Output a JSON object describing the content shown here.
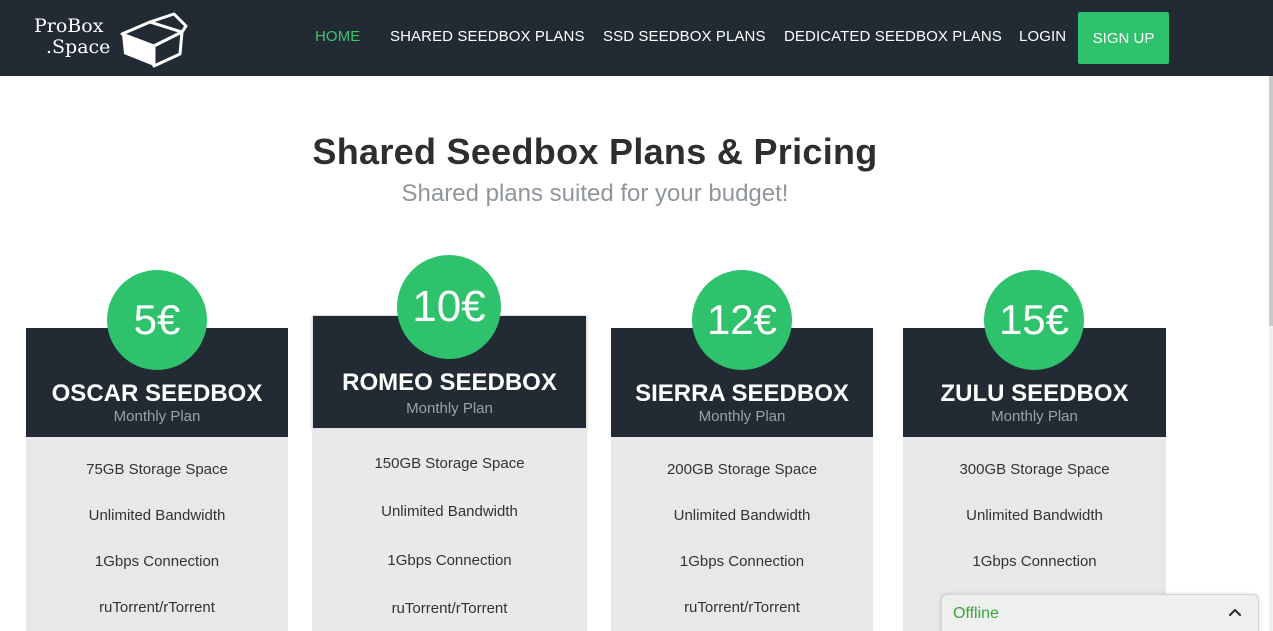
{
  "header": {
    "logo_line1": "ProBox",
    "logo_line2": ".Space",
    "nav": [
      {
        "label": "HOME",
        "active": true
      },
      {
        "label": "SHARED SEEDBOX PLANS",
        "active": false
      },
      {
        "label": "SSD SEEDBOX PLANS",
        "active": false
      },
      {
        "label": "DEDICATED SEEDBOX PLANS",
        "active": false
      },
      {
        "label": "LOGIN",
        "active": false
      }
    ],
    "signup_label": "SIGN UP"
  },
  "main": {
    "title": "Shared Seedbox Plans & Pricing",
    "subtitle": "Shared plans suited for your budget!"
  },
  "plans": [
    {
      "price": "5€",
      "name": "OSCAR SEEDBOX",
      "period": "Monthly Plan",
      "features": [
        "75GB Storage Space",
        "Unlimited Bandwidth",
        "1Gbps Connection",
        "ruTorrent/rTorrent"
      ]
    },
    {
      "price": "10€",
      "name": "ROMEO SEEDBOX",
      "period": "Monthly Plan",
      "features": [
        "150GB Storage Space",
        "Unlimited Bandwidth",
        "1Gbps Connection",
        "ruTorrent/rTorrent"
      ]
    },
    {
      "price": "12€",
      "name": "SIERRA SEEDBOX",
      "period": "Monthly Plan",
      "features": [
        "200GB Storage Space",
        "Unlimited Bandwidth",
        "1Gbps Connection",
        "ruTorrent/rTorrent"
      ]
    },
    {
      "price": "15€",
      "name": "ZULU SEEDBOX",
      "period": "Monthly Plan",
      "features": [
        "300GB Storage Space",
        "Unlimited Bandwidth",
        "1Gbps Connection"
      ]
    }
  ],
  "chat": {
    "status": "Offline",
    "toggle_icon": "chevron-up-icon"
  },
  "colors": {
    "header_bg": "#222a33",
    "accent_green": "#2dc26b",
    "card_body": "#e8e8ea"
  }
}
